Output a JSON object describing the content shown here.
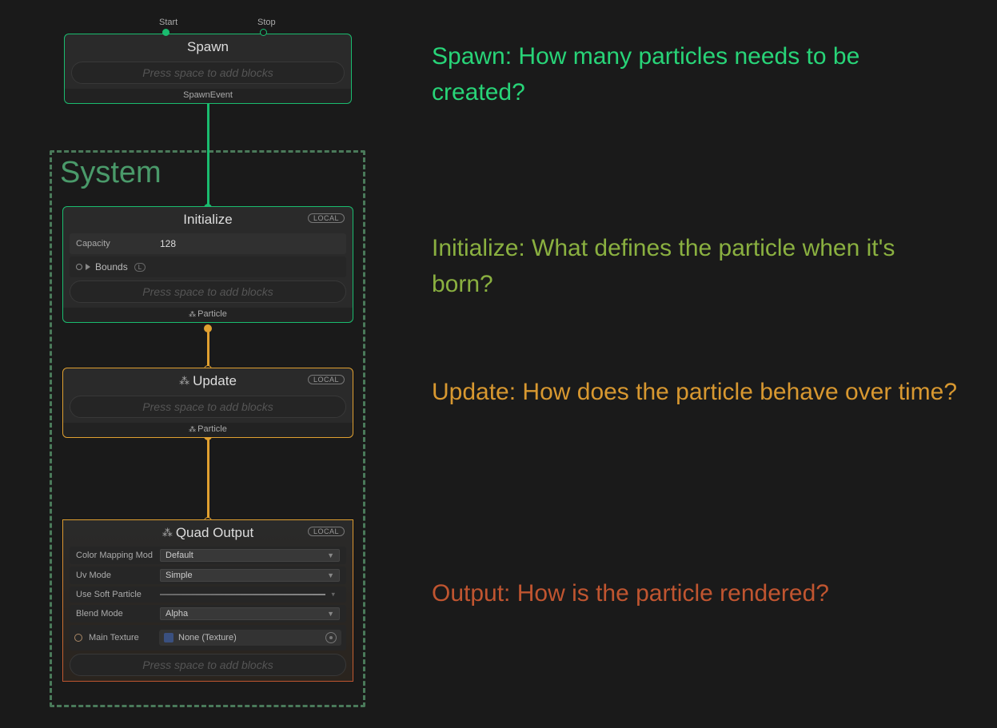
{
  "system_label": "System",
  "spawn": {
    "title": "Spawn",
    "start": "Start",
    "stop": "Stop",
    "add_blocks": "Press space to add blocks",
    "out": "SpawnEvent"
  },
  "initialize": {
    "title": "Initialize",
    "badge": "LOCAL",
    "capacity_label": "Capacity",
    "capacity_value": "128",
    "bounds_label": "Bounds",
    "bounds_badge": "L",
    "add_blocks": "Press space to add blocks",
    "out": "Particle"
  },
  "update": {
    "title": "Update",
    "badge": "LOCAL",
    "add_blocks": "Press space to add blocks",
    "out": "Particle"
  },
  "output": {
    "title": "Quad Output",
    "badge": "LOCAL",
    "cmm_label": "Color Mapping Mod",
    "cmm_value": "Default",
    "uv_label": "Uv Mode",
    "uv_value": "Simple",
    "soft_label": "Use Soft Particle",
    "blend_label": "Blend Mode",
    "blend_value": "Alpha",
    "tex_label": "Main Texture",
    "tex_value": "None (Texture)",
    "add_blocks": "Press space to add blocks"
  },
  "descriptions": {
    "spawn": "Spawn: How many particles needs to be created?",
    "initialize": "Initialize: What defines the particle when it's born?",
    "update": "Update: How does the particle behave over time?",
    "output": "Output: How is the particle rendered?"
  }
}
